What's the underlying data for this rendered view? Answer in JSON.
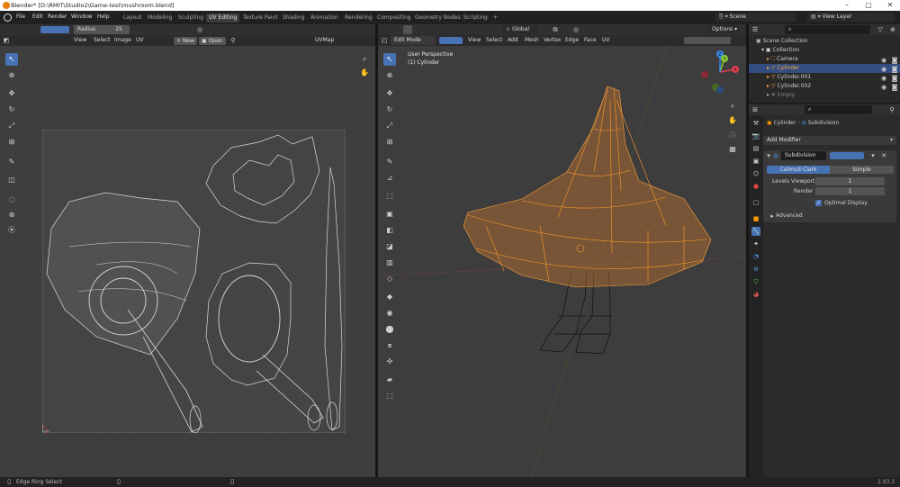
{
  "window": {
    "title": "Blender* [D:\\RMIT\\Studio2\\Game-test\\mushroom.blend]"
  },
  "menu": [
    "File",
    "Edit",
    "Render",
    "Window",
    "Help"
  ],
  "workspaces": [
    "Layout",
    "Modeling",
    "Sculpting",
    "UV Editing",
    "Texture Paint",
    "Shading",
    "Animation",
    "Rendering",
    "Compositing",
    "Geometry Nodes",
    "Scripting"
  ],
  "active_workspace": "UV Editing",
  "scene": {
    "label": "Scene",
    "view_layer": "View Layer"
  },
  "uv_editor": {
    "tool_settings": {
      "falloff": "Radius",
      "value": "25"
    },
    "menus": [
      "View",
      "Select",
      "Image",
      "UV"
    ],
    "new_label": "New",
    "open_label": "Open",
    "uv_map": "UVMap"
  },
  "viewport": {
    "mode": "Edit Mode",
    "menus": [
      "View",
      "Select",
      "Add",
      "Mesh",
      "Vertex",
      "Edge",
      "Face",
      "UV"
    ],
    "orientation": "Global",
    "options_label": "Options",
    "info_line1": "User Perspective",
    "info_line2": "(1) Cylinder",
    "gizmo_axes": [
      "X",
      "Y",
      "Z"
    ]
  },
  "outliner": {
    "scene_collection": "Scene Collection",
    "collection": "Collection",
    "items": [
      "Camera",
      "Cylinder",
      "Cylinder.001",
      "Cylinder.002",
      "Empty"
    ],
    "selected": "Cylinder"
  },
  "properties": {
    "object": "Cylinder",
    "modifier_tab": "Subdivision",
    "add_modifier": "Add Modifier",
    "modifier_name": "Subdivision",
    "method_catmull": "Catmull-Clark",
    "method_simple": "Simple",
    "levels_viewport_label": "Levels Viewport",
    "levels_viewport": "1",
    "render_label": "Render",
    "render": "1",
    "optimal_display": "Optimal Display",
    "advanced": "Advanced"
  },
  "status": {
    "left": "Edge Ring Select",
    "version": "2.93.3"
  },
  "colors": {
    "accent": "#4772b3",
    "selection": "#ff9b2b",
    "window_bg": "#303030"
  }
}
